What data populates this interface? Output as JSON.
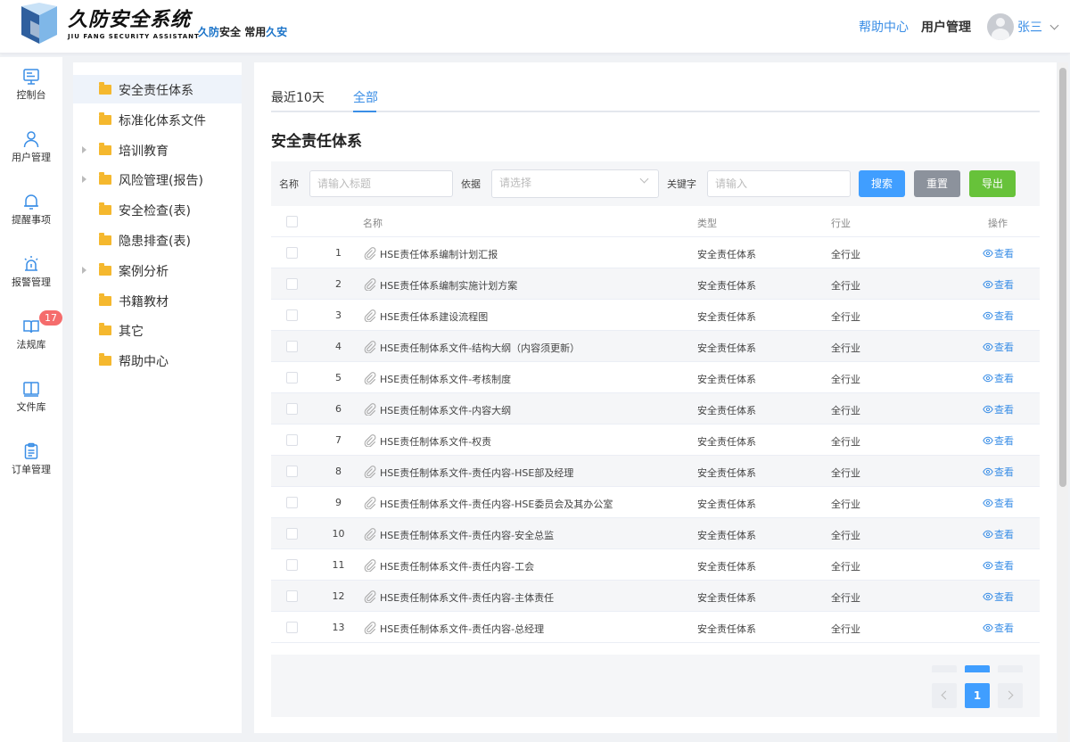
{
  "header": {
    "logo_title": "久防安全系统",
    "logo_subtitle": "JIU FANG SECURITY ASSISTANT",
    "slogan_part1": "久防",
    "slogan_part2": "安全",
    "slogan_part3": "常用",
    "slogan_part4": "久安",
    "help_link": "帮助中心",
    "user_mgmt_link": "用户管理",
    "username": "张三"
  },
  "nav": {
    "items": [
      {
        "label": "控制台",
        "icon": "monitor-icon"
      },
      {
        "label": "用户管理",
        "icon": "user-icon"
      },
      {
        "label": "提醒事项",
        "icon": "bell-icon"
      },
      {
        "label": "报警管理",
        "icon": "alarm-icon"
      },
      {
        "label": "法规库",
        "icon": "book-icon",
        "badge": "17"
      },
      {
        "label": "文件库",
        "icon": "book-open-icon"
      },
      {
        "label": "订单管理",
        "icon": "clipboard-icon"
      }
    ]
  },
  "tree": {
    "items": [
      {
        "label": "安全责任体系",
        "expandable": false,
        "active": true
      },
      {
        "label": "标准化体系文件",
        "expandable": false
      },
      {
        "label": "培训教育",
        "expandable": true
      },
      {
        "label": "风险管理(报告)",
        "expandable": true
      },
      {
        "label": "安全检查(表)",
        "expandable": false
      },
      {
        "label": "隐患排查(表)",
        "expandable": false
      },
      {
        "label": "案例分析",
        "expandable": true
      },
      {
        "label": "书籍教材",
        "expandable": false
      },
      {
        "label": "其它",
        "expandable": false
      },
      {
        "label": "帮助中心",
        "expandable": false
      }
    ]
  },
  "tabs": [
    {
      "label": "最近10天",
      "active": false
    },
    {
      "label": "全部",
      "active": true
    }
  ],
  "section_title": "安全责任体系",
  "filter": {
    "name_label": "名称",
    "name_placeholder": "请输入标题",
    "basis_label": "依据",
    "basis_placeholder": "请选择",
    "keyword_label": "关键字",
    "keyword_placeholder": "请输入",
    "search_label": "搜索",
    "reset_label": "重置",
    "export_label": "导出"
  },
  "colors": {
    "accent": "#3a8ee6",
    "search_btn": "#409eff",
    "reset_btn": "#8c929c",
    "export_btn": "#67c23a",
    "badge": "#f56c6c",
    "folder": "#f5b82e"
  },
  "table": {
    "headers": {
      "name": "名称",
      "type": "类型",
      "industry": "行业",
      "action": "操作"
    },
    "view_label": "查看",
    "rows": [
      {
        "no": "1",
        "name": "HSE责任体系编制计划汇报",
        "type": "安全责任体系",
        "industry": "全行业"
      },
      {
        "no": "2",
        "name": "HSE责任体系编制实施计划方案",
        "type": "安全责任体系",
        "industry": "全行业"
      },
      {
        "no": "3",
        "name": "HSE责任体系建设流程图",
        "type": "安全责任体系",
        "industry": "全行业"
      },
      {
        "no": "4",
        "name": "HSE责任制体系文件-结构大纲（内容须更新）",
        "type": "安全责任体系",
        "industry": "全行业"
      },
      {
        "no": "5",
        "name": "HSE责任制体系文件-考核制度",
        "type": "安全责任体系",
        "industry": "全行业"
      },
      {
        "no": "6",
        "name": "HSE责任制体系文件-内容大纲",
        "type": "安全责任体系",
        "industry": "全行业"
      },
      {
        "no": "7",
        "name": "HSE责任制体系文件-权责",
        "type": "安全责任体系",
        "industry": "全行业"
      },
      {
        "no": "8",
        "name": "HSE责任制体系文件-责任内容-HSE部及经理",
        "type": "安全责任体系",
        "industry": "全行业"
      },
      {
        "no": "9",
        "name": "HSE责任制体系文件-责任内容-HSE委员会及其办公室",
        "type": "安全责任体系",
        "industry": "全行业"
      },
      {
        "no": "10",
        "name": "HSE责任制体系文件-责任内容-安全总监",
        "type": "安全责任体系",
        "industry": "全行业"
      },
      {
        "no": "11",
        "name": "HSE责任制体系文件-责任内容-工会",
        "type": "安全责任体系",
        "industry": "全行业"
      },
      {
        "no": "12",
        "name": "HSE责任制体系文件-责任内容-主体责任",
        "type": "安全责任体系",
        "industry": "全行业"
      },
      {
        "no": "13",
        "name": "HSE责任制体系文件-责任内容-总经理",
        "type": "安全责任体系",
        "industry": "全行业"
      }
    ]
  },
  "pagination": {
    "current_page": "1"
  }
}
